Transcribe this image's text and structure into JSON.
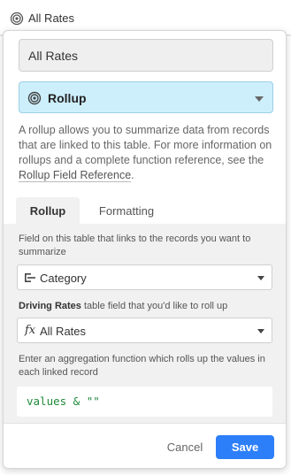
{
  "header": {
    "field_title": "All Rates",
    "field_icon": "rollup-icon"
  },
  "popover": {
    "field_name": "All Rates",
    "field_type": {
      "label": "Rollup",
      "icon": "rollup-icon"
    },
    "description": {
      "text": "A rollup allows you to summarize data from records that are linked to this table. For more information on rollups and a complete function reference, see the",
      "link_text": "Rollup Field Reference",
      "suffix": "."
    },
    "tabs": [
      {
        "label": "Rollup",
        "active": true
      },
      {
        "label": "Formatting",
        "active": false
      }
    ],
    "link_field": {
      "label": "Field on this table that links to the records you want to summarize",
      "selected": "Category",
      "icon": "linked-record-icon"
    },
    "rollup_field": {
      "label_bold": "Driving Rates",
      "label_rest": " table field that you'd like to roll up",
      "selected": "All Rates",
      "icon": "formula-fx-icon",
      "icon_glyph": "fx"
    },
    "aggregation": {
      "label": "Enter an aggregation function which rolls up the values in each linked record",
      "formula": "values & \"\""
    },
    "actions": {
      "cancel_label": "Cancel",
      "save_label": "Save"
    }
  },
  "colors": {
    "accent": "#2d7ff9",
    "type_select_bg": "#cdeffc",
    "formula_text": "#1f8a3a"
  }
}
